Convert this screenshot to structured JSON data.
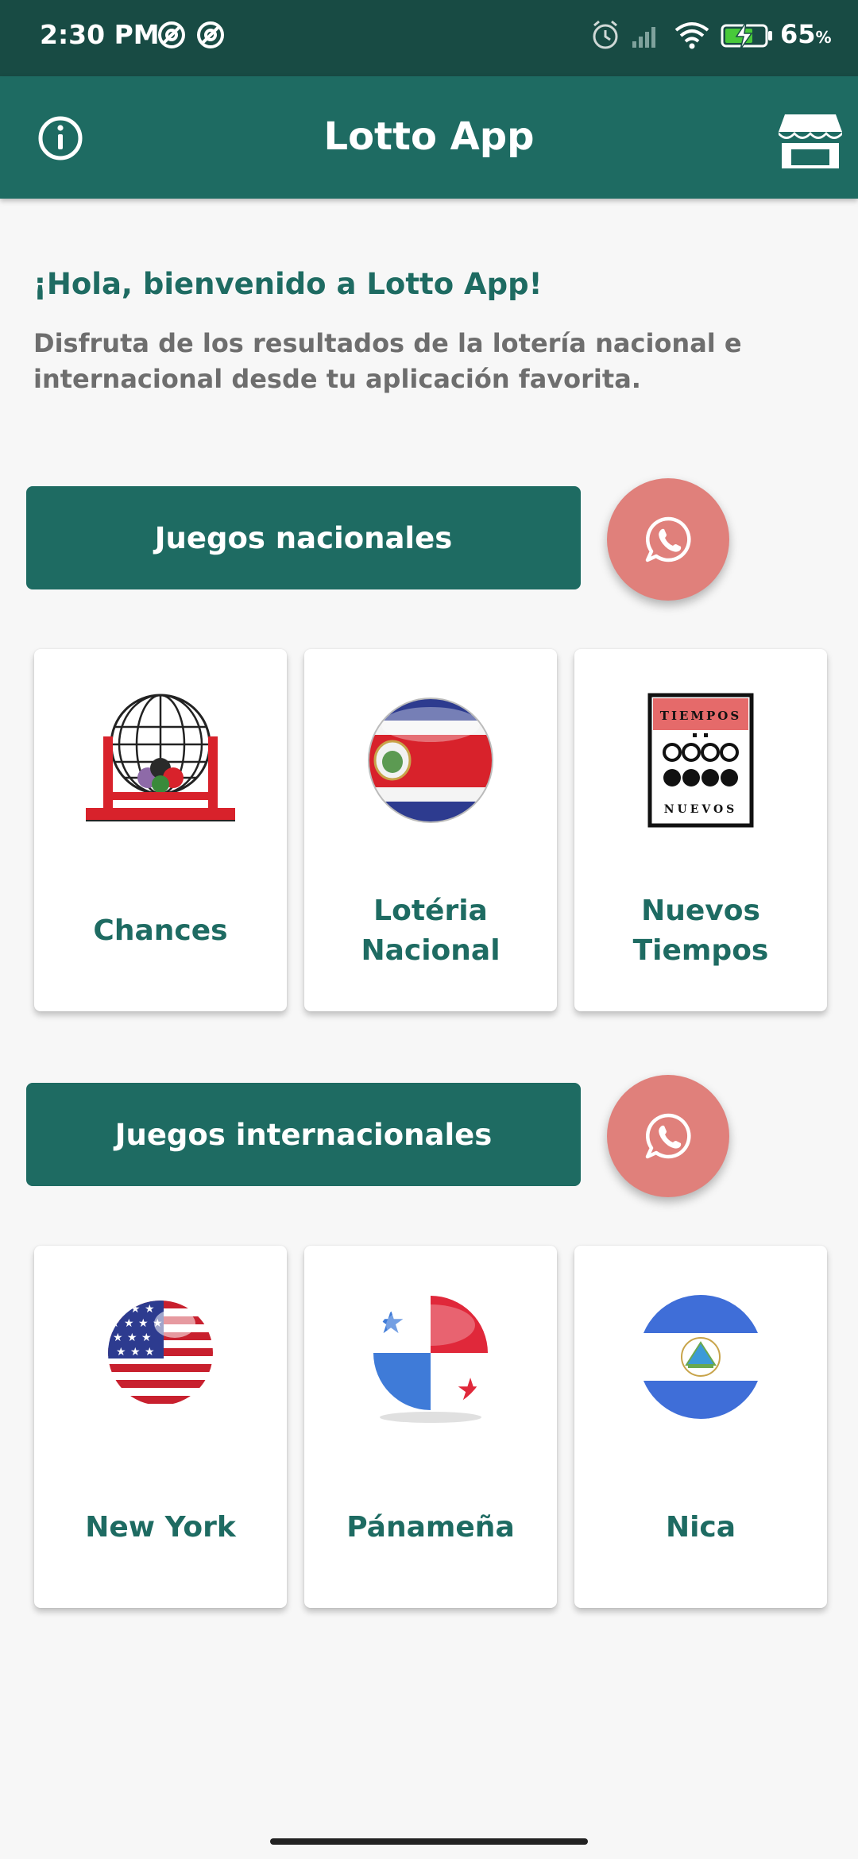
{
  "status_bar": {
    "time": "2:30 PM",
    "icons": [
      "alarm-icon",
      "signal-icon",
      "wifi-icon",
      "battery-charging-icon"
    ],
    "battery_percent": "65",
    "battery_unit": "%"
  },
  "app_bar": {
    "title": "Lotto App",
    "left_icon": "info-icon",
    "right_icon": "store-icon"
  },
  "welcome": {
    "title": "¡Hola, bienvenido a Lotto App!",
    "text": "Disfruta de los resultados de la lotería nacional e internacional desde tu aplicación favorita."
  },
  "sections": {
    "national": {
      "button_label": "Juegos nacionales",
      "whatsapp_icon": "whatsapp-icon",
      "cards": [
        {
          "line1": "Chances",
          "line2": "",
          "image": "bingo-cage-icon"
        },
        {
          "line1": "Lotéria",
          "line2": "Nacional",
          "image": "costa-rica-flag-icon"
        },
        {
          "line1": "Nuevos",
          "line2": "Tiempos",
          "image": "nuevos-tiempos-logo"
        }
      ],
      "tiempos_logo": {
        "top": "TIEMPOS",
        "bottom": "NUEVOS"
      }
    },
    "international": {
      "button_label": "Juegos internacionales",
      "whatsapp_icon": "whatsapp-icon",
      "cards": [
        {
          "line1": "New York",
          "line2": "",
          "image": "usa-flag-icon"
        },
        {
          "line1": "Pánameña",
          "line2": "",
          "image": "panama-flag-icon"
        },
        {
          "line1": "Nica",
          "line2": "",
          "image": "nicaragua-flag-icon"
        }
      ]
    }
  },
  "colors": {
    "primary": "#1e6b62",
    "status_bar": "#184b44",
    "whatsapp_button": "#e0807b",
    "background": "#f7f7f7"
  }
}
